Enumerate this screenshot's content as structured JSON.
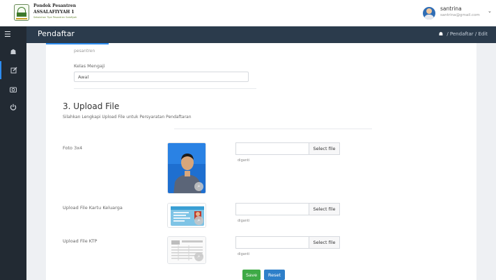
{
  "header": {
    "brand_line1": "Pondok Pesantren",
    "brand_line2": "ASSALAFIYYAH 1",
    "brand_tagline": "Sekolahan Tipe Pesantren Salafiyah",
    "user_name": "santrina",
    "user_email": "santrina@gmail.com"
  },
  "sidebar": {
    "items": [
      "menu-icon",
      "home-icon",
      "edit-icon",
      "camera-icon",
      "power-icon"
    ],
    "accent": "#2d8cf0"
  },
  "titlebar": {
    "title": "Pendaftar",
    "breadcrumb": [
      "Pendaftar",
      "Edit"
    ],
    "separator": "/"
  },
  "form": {
    "faded_text": "pesantren",
    "kelas_label": "Kelas Mengaji",
    "kelas_value": "Awal",
    "section_title": "3. Upload File",
    "section_sub": "Silahkan Lengkapi Upload File untuk Persyaratan Pendaftaran",
    "uploads": [
      {
        "label": "Foto 3x4",
        "button": "Select file",
        "hint": "diganti"
      },
      {
        "label": "Upload File Kartu Keluarga",
        "button": "Select file",
        "hint": "diganti"
      },
      {
        "label": "Upload File KTP",
        "button": "Select file",
        "hint": "diganti"
      }
    ],
    "save_label": "Save",
    "reset_label": "Reset"
  },
  "colors": {
    "sidebar_bg": "#222a33",
    "titlebar_bg": "#2b3b4c",
    "save": "#3eaa46",
    "reset": "#2e7fc9"
  }
}
